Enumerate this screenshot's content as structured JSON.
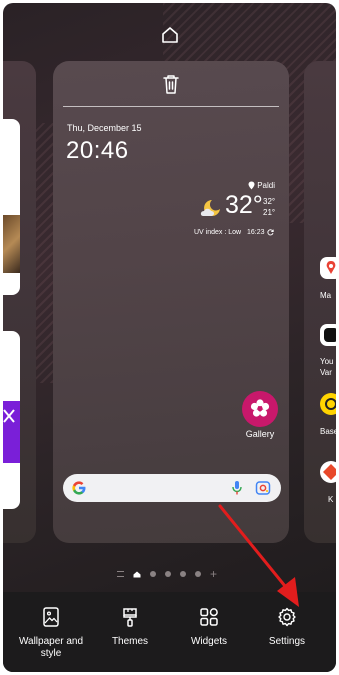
{
  "center_page": {
    "date": "Thu, December 15",
    "time": "20:46",
    "weather": {
      "location": "Paldi",
      "temperature": "32°",
      "high": "32°",
      "low": "21°",
      "uv": "UV index : Low",
      "updated": "16:23"
    },
    "gallery_label": "Gallery"
  },
  "right_page": {
    "labels": [
      "Ma",
      "You",
      "Var",
      "Base",
      "K"
    ]
  },
  "bottom_bar": {
    "items": [
      {
        "label": "Wallpaper and style",
        "icon": "wallpaper-icon"
      },
      {
        "label": "Themes",
        "icon": "themes-brush-icon"
      },
      {
        "label": "Widgets",
        "icon": "widgets-grid-icon"
      },
      {
        "label": "Settings",
        "icon": "gear-icon"
      }
    ]
  },
  "colors": {
    "accent_arrow": "#e21d1d",
    "gallery": "#c8186b",
    "bottom_bar": "#1c1b1c"
  }
}
